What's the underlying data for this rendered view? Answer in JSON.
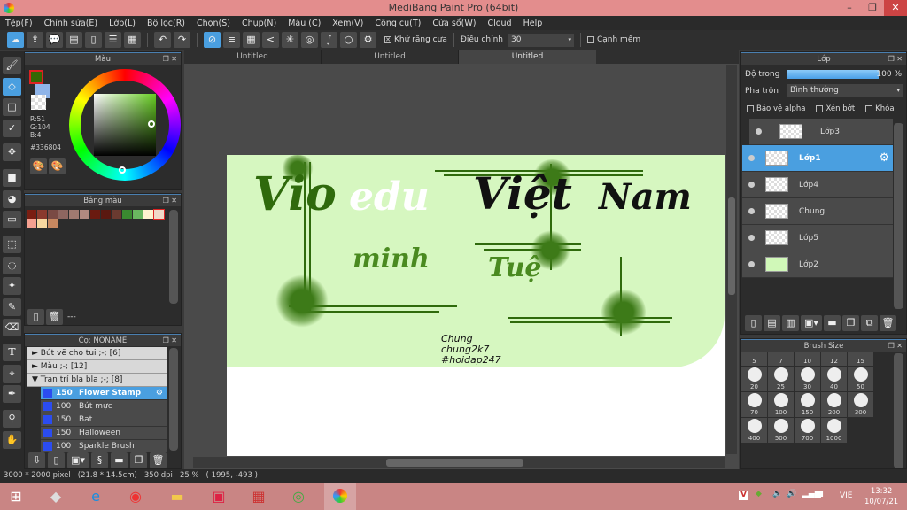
{
  "window": {
    "title": "MediBang Paint Pro (64bit)",
    "minimize": "–",
    "maximize": "❐",
    "close": "✕"
  },
  "menu": [
    "Tệp(F)",
    "Chỉnh sửa(E)",
    "Lớp(L)",
    "Bộ lọc(R)",
    "Chọn(S)",
    "Chụp(N)",
    "Màu (C)",
    "Xem(V)",
    "Công cụ(T)",
    "Cửa sổ(W)",
    "Cloud",
    "Help"
  ],
  "toolbar": {
    "antialias_label": "Khử răng cưa",
    "antialias_checked": true,
    "adjust_label": "Điều chỉnh",
    "adjust_value": "30",
    "soft_edge_label": "Cạnh mềm",
    "soft_edge_checked": false
  },
  "color_panel": {
    "title": "Màu",
    "r": "R:51",
    "g": "G:104",
    "b": "B:4",
    "hex": "#336804",
    "fg_color": "#336804",
    "bg_color": "#8fb4e8"
  },
  "palette_panel": {
    "title": "Bảng màu",
    "colors": [
      "#7a1e12",
      "#8a3a2e",
      "#7a4a44",
      "#8e6660",
      "#a07a70",
      "#b08a80",
      "#6a1a10",
      "#5a1810",
      "#6a3a30",
      "#3a8a30",
      "#6ab860",
      "#fff4d0",
      "#f0d8c8",
      "#f5a090",
      "#f8d8a0",
      "#c88860"
    ],
    "footer": "---"
  },
  "brush_panel": {
    "title": "Cọ: NONAME",
    "groups": [
      {
        "label": "Bút vẽ cho tui ;-; [6]",
        "open": false
      },
      {
        "label": "Màu ;-; [12]",
        "open": false
      },
      {
        "label": "Tran trí bla bla ;-; [8]",
        "open": true
      }
    ],
    "items": [
      {
        "size": "150",
        "name": "Flower Stamp",
        "selected": true
      },
      {
        "size": "100",
        "name": "Bút mực"
      },
      {
        "size": "150",
        "name": "Bat"
      },
      {
        "size": "150",
        "name": "Halloween"
      },
      {
        "size": "100",
        "name": "Sparkle Brush"
      }
    ]
  },
  "tabs": [
    "Untitled",
    "Untitled",
    "Untitled"
  ],
  "canvas": {
    "title1": "Vio",
    "title1b": "edu",
    "title2": "Việt",
    "title3": "Nam",
    "sub1": "minh",
    "sub2": "Tuệ",
    "credit": [
      "Chung",
      "chung2k7",
      "#hoidap247"
    ]
  },
  "layer_panel": {
    "title": "Lớp",
    "opacity_label": "Độ trong",
    "opacity_value": "100 %",
    "opacity": 100,
    "blend_label": "Pha trộn",
    "blend_value": "Bình thường",
    "protect_alpha": "Bảo vệ alpha",
    "clip": "Xén bớt",
    "lock": "Khóa",
    "layers": [
      {
        "name": "Lớp3"
      },
      {
        "name": "Lớp1",
        "selected": true
      },
      {
        "name": "Lớp4"
      },
      {
        "name": "Chung"
      },
      {
        "name": "Lớp5"
      },
      {
        "name": "Lớp2"
      }
    ]
  },
  "brush_size_panel": {
    "title": "Brush Size",
    "sizes": [
      "5",
      "7",
      "10",
      "12",
      "15",
      "20",
      "25",
      "30",
      "40",
      "50",
      "70",
      "100",
      "150",
      "200",
      "300",
      "400",
      "500",
      "700",
      "1000"
    ]
  },
  "status": {
    "size": "3000 * 2000 pixel",
    "cm": "(21.8 * 14.5cm)",
    "dpi": "350 dpi",
    "zoom": "25 %",
    "coords": "( 1995, -493 )"
  },
  "taskbar": {
    "lang": "VIE",
    "time": "13:32",
    "date": "10/07/21"
  }
}
